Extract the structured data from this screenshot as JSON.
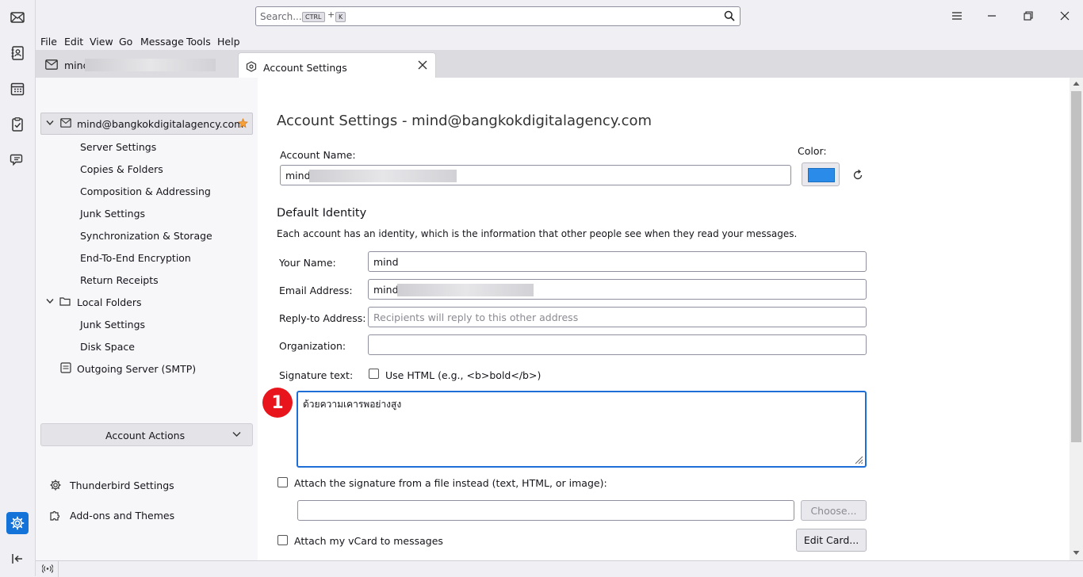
{
  "search": {
    "placeholder": "Search...",
    "kbd_ctrl": "CTRL",
    "kbd_plus": "+",
    "kbd_k": "K"
  },
  "menu": [
    "File",
    "Edit",
    "View",
    "Go",
    "Message",
    "Tools",
    "Help"
  ],
  "tabs": {
    "mail_label": "mind",
    "account_settings_label": "Account Settings"
  },
  "sidebar": {
    "account": "mind@bangkokdigitalagency.com",
    "items": [
      "Server Settings",
      "Copies & Folders",
      "Composition & Addressing",
      "Junk Settings",
      "Synchronization & Storage",
      "End-To-End Encryption",
      "Return Receipts"
    ],
    "local_folders": "Local Folders",
    "local_items": [
      "Junk Settings",
      "Disk Space"
    ],
    "outgoing": "Outgoing Server (SMTP)",
    "account_actions": "Account Actions",
    "thunderbird_settings": "Thunderbird Settings",
    "addons": "Add-ons and Themes"
  },
  "main": {
    "title": "Account Settings - mind@bangkokdigitalagency.com",
    "account_name_label": "Account Name:",
    "account_name_value": "mind",
    "color_label": "Color:",
    "color_value": "#2a8ce8",
    "default_identity_heading": "Default Identity",
    "identity_desc": "Each account has an identity, which is the information that other people see when they read your messages.",
    "your_name_label": "Your Name:",
    "your_name_value": "mind",
    "email_label": "Email Address:",
    "email_value": "mind",
    "reply_to_label": "Reply-to Address:",
    "reply_to_placeholder": "Recipients will reply to this other address",
    "organization_label": "Organization:",
    "signature_label": "Signature text:",
    "use_html_label": "Use HTML (e.g., <b>bold</b>)",
    "signature_text": "ด้วยความเคารพอย่างสูง",
    "step_badge": "1",
    "attach_sig_label": "Attach the signature from a file instead (text, HTML, or image):",
    "choose_button": "Choose...",
    "attach_vcard_label": "Attach my vCard to messages",
    "edit_card_button": "Edit Card..."
  }
}
